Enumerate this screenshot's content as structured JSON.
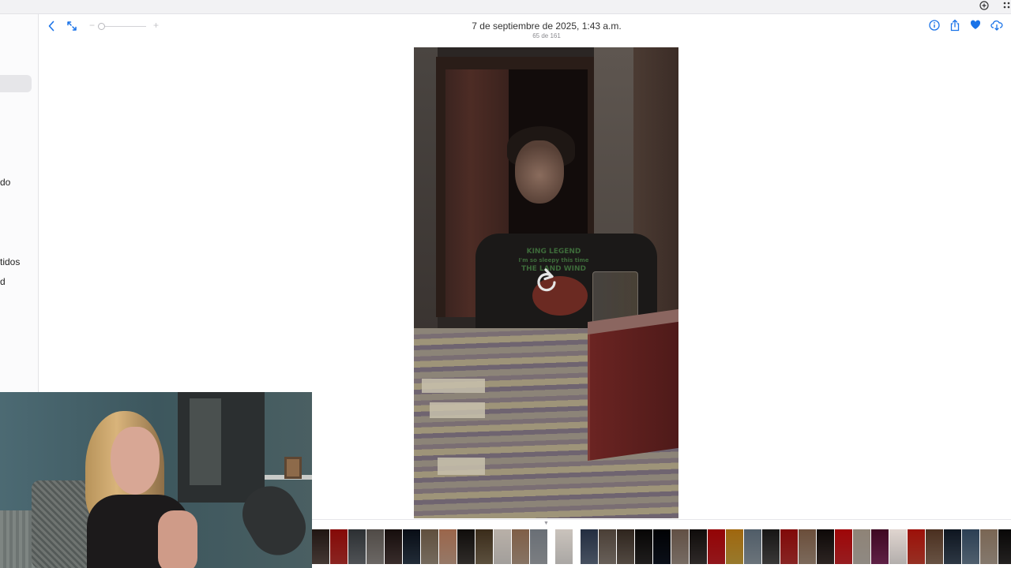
{
  "window": {
    "top_icons": [
      "plus-circle-icon",
      "grid-icon"
    ]
  },
  "sidebar": {
    "visible_labels": [
      {
        "text": "do"
      },
      {
        "text": "tidos"
      },
      {
        "text": "d"
      }
    ]
  },
  "toolbar": {
    "back_icon": "chevron-left-icon",
    "fullscreen_icon": "expand-arrows-icon",
    "zoom_minus": "−",
    "zoom_plus": "+",
    "zoom_level": 0.05
  },
  "header": {
    "title": "7 de septiembre de 2025, 1:43 a.m.",
    "subtitle": "65 de 161"
  },
  "actions": {
    "icons": [
      "info-icon",
      "share-icon",
      "heart-icon",
      "download-cloud-icon"
    ],
    "accent_color": "#1a73e8",
    "favorite_color": "#1a73e8"
  },
  "photo": {
    "shirt_text": [
      "KING LEGEND",
      "I'm so sleepy this time",
      "THE LAND WIND"
    ],
    "reload_icon": "reload-icon"
  },
  "filmstrip": {
    "current_marker": "▼",
    "thumbnails": [
      {
        "color": "#5a4a44"
      },
      {
        "color": "#b8312c"
      },
      {
        "color": "#6a6e72"
      },
      {
        "color": "#8f8a86"
      },
      {
        "color": "#4b3b39"
      },
      {
        "color": "#2d3a4a"
      },
      {
        "color": "#9c8e7d"
      },
      {
        "color": "#c7a18a"
      },
      {
        "color": "#3f3a36"
      },
      {
        "color": "#7a6a52"
      },
      {
        "color": "#d9d4cf"
      },
      {
        "color": "#b49b86"
      },
      {
        "color": "#a4a8ad"
      },
      {
        "color": "gap"
      },
      {
        "color": "#e3dfdb"
      },
      {
        "color": "gap"
      },
      {
        "color": "#5f6c80"
      },
      {
        "color": "#8a7f76"
      },
      {
        "color": "#6d6157"
      },
      {
        "color": "#2a2726"
      },
      {
        "color": "#0e1420"
      },
      {
        "color": "#9e8f84"
      },
      {
        "color": "#3e3735"
      },
      {
        "color": "#c21f25"
      },
      {
        "color": "#caa23c"
      },
      {
        "color": "#8f9aa3"
      },
      {
        "color": "#4c4a49"
      },
      {
        "color": "#b5312f"
      },
      {
        "color": "#a58d7a"
      },
      {
        "color": "#3b302d"
      },
      {
        "color": "#c9272b"
      },
      {
        "color": "#bfb7ae"
      },
      {
        "color": "#7e2b5c"
      },
      {
        "color": "#efe9e6"
      },
      {
        "color": "#c8402f"
      },
      {
        "color": "#8a6e5a"
      },
      {
        "color": "#3c4a5a"
      },
      {
        "color": "#6a7f92"
      },
      {
        "color": "#b0a192"
      },
      {
        "color": "#2f2c2b"
      },
      {
        "color": "#d5cfc8"
      },
      {
        "color": "#4e5b62"
      }
    ]
  }
}
